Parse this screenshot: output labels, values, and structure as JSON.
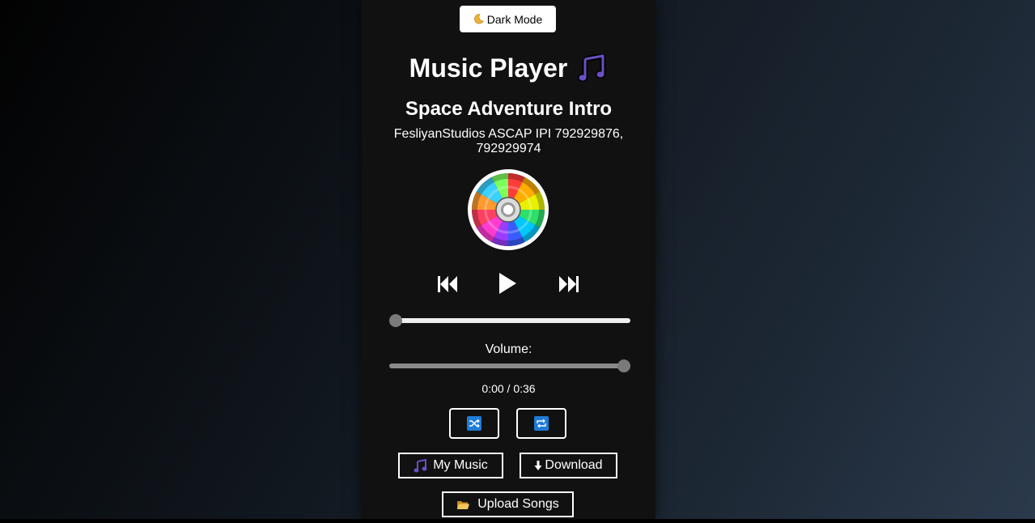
{
  "header": {
    "dark_mode_label": "Dark Mode",
    "app_title": "Music Player"
  },
  "now_playing": {
    "title": "Space Adventure Intro",
    "artist": "FesliyanStudios ASCAP IPI 792929876, 792929974"
  },
  "progress": {
    "value_fraction": 0.0
  },
  "volume": {
    "label": "Volume:",
    "value_fraction": 1.0
  },
  "time": {
    "display": "0:00 / 0:36"
  },
  "buttons": {
    "my_music": "My Music",
    "download": "Download",
    "upload": "Upload Songs"
  },
  "icons": {
    "dark_mode": "moon-icon",
    "title": "music-notes-icon",
    "disc": "cd-disc-icon",
    "previous": "skip-previous-icon",
    "play": "play-icon",
    "next": "skip-next-icon",
    "shuffle": "shuffle-icon",
    "repeat": "repeat-icon",
    "my_music": "music-notes-icon",
    "download": "download-arrow-icon",
    "upload": "open-folder-icon"
  },
  "colors": {
    "panel_bg": "#111111",
    "accent_blue": "#1e7bd6",
    "note_purple": "#6a4fc4",
    "slider_thumb": "#7a7a7a"
  }
}
